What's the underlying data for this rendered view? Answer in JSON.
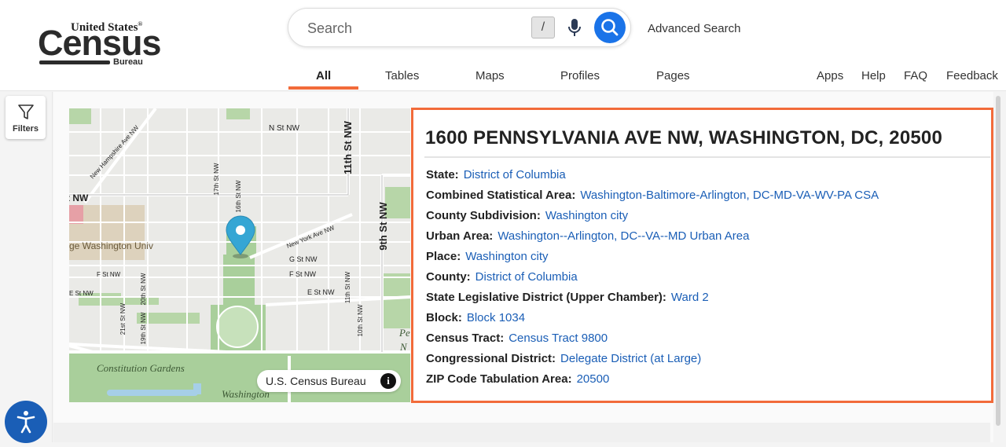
{
  "logo": {
    "top": "United States",
    "reg": "®",
    "main": "Census",
    "bureau": "Bureau"
  },
  "search": {
    "placeholder": "Search",
    "shortcut": "/",
    "advanced": "Advanced Search"
  },
  "tabs": [
    {
      "label": "All",
      "active": true
    },
    {
      "label": "Tables",
      "active": false
    },
    {
      "label": "Maps",
      "active": false
    },
    {
      "label": "Profiles",
      "active": false
    },
    {
      "label": "Pages",
      "active": false
    }
  ],
  "header_links": [
    "Apps",
    "Help",
    "FAQ",
    "Feedback"
  ],
  "filters": {
    "label": "Filters"
  },
  "map": {
    "labels": [
      "N St NW",
      "11th St NW",
      "9th St NW",
      "New Hampshire Ave NW",
      "17th St NW",
      "16th St NW",
      "New York Ave NW",
      "G St NW",
      "F St NW",
      "E St NW",
      "11th St NW",
      "10th St NW",
      "21st St NW",
      "20th St NW",
      "19th St NW",
      "ge Washington Univ",
      "Constitution Gardens",
      "Washington",
      "t NW",
      "F St NW",
      "E St NW",
      "Pe",
      "N"
    ],
    "attribution": "U.S. Census Bureau",
    "info_glyph": "i"
  },
  "result": {
    "address": "1600 PENNSYLVANIA AVE NW, WASHINGTON, DC, 20500",
    "fields": [
      {
        "key": "State:",
        "value": "District of Columbia"
      },
      {
        "key": "Combined Statistical Area:",
        "value": "Washington-Baltimore-Arlington, DC-MD-VA-WV-PA CSA"
      },
      {
        "key": "County Subdivision:",
        "value": "Washington city"
      },
      {
        "key": "Urban Area:",
        "value": "Washington--Arlington, DC--VA--MD Urban Area"
      },
      {
        "key": "Place:",
        "value": "Washington city"
      },
      {
        "key": "County:",
        "value": "District of Columbia"
      },
      {
        "key": "State Legislative District (Upper Chamber):",
        "value": "Ward 2"
      },
      {
        "key": "Block:",
        "value": "Block 1034"
      },
      {
        "key": "Census Tract:",
        "value": "Census Tract 9800"
      },
      {
        "key": "Congressional District:",
        "value": "Delegate District (at Large)"
      },
      {
        "key": "ZIP Code Tabulation Area:",
        "value": "20500"
      }
    ]
  },
  "colors": {
    "accent": "#f26b3a",
    "link": "#1a5eb6",
    "search_button": "#1a73e8",
    "marker": "#35a6d4",
    "park": "#a9cf9b"
  }
}
